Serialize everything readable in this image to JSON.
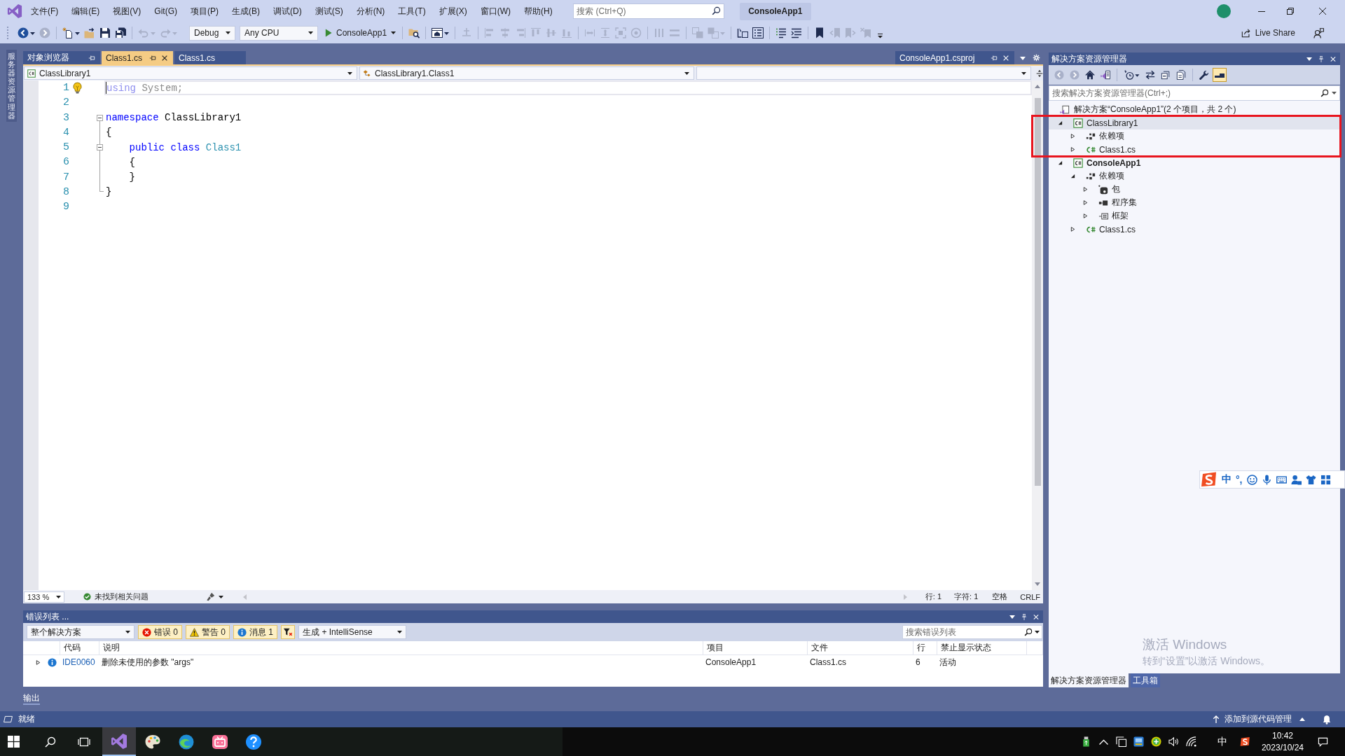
{
  "title_bar": {
    "menu": [
      "文件(F)",
      "编辑(E)",
      "视图(V)",
      "Git(G)",
      "项目(P)",
      "生成(B)",
      "调试(D)",
      "测试(S)",
      "分析(N)",
      "工具(T)",
      "扩展(X)",
      "窗口(W)",
      "帮助(H)"
    ],
    "search": {
      "placeholder": "搜索 (Ctrl+Q)"
    },
    "solution_name": "ConsoleApp1"
  },
  "toolbar": {
    "groups_before": [
      [
        {
          "kind": "back",
          "disabled": false,
          "menu": true
        },
        {
          "kind": "forward",
          "disabled": true,
          "menu": false
        }
      ],
      [
        {
          "kind": "new-item",
          "disabled": false,
          "menu": true
        },
        {
          "kind": "folder-open",
          "disabled": false,
          "menu": false
        },
        {
          "kind": "save",
          "disabled": false,
          "menu": false
        },
        {
          "kind": "save-all",
          "disabled": false,
          "menu": false
        }
      ],
      [
        {
          "kind": "undo",
          "disabled": true,
          "menu": true
        },
        {
          "kind": "redo",
          "disabled": true,
          "menu": true
        }
      ]
    ],
    "configuration": "Debug",
    "platform": "Any CPU",
    "start": "ConsoleApp1",
    "groups_after": [
      [
        {
          "kind": "folder-search",
          "disabled": false,
          "menu": false
        }
      ],
      [
        {
          "kind": "browser-window",
          "disabled": false,
          "menu": true
        }
      ],
      [
        {
          "kind": "snap-line",
          "disabled": true,
          "menu": false
        }
      ],
      [
        {
          "kind": "align-left",
          "disabled": true,
          "menu": false
        },
        {
          "kind": "align-center",
          "disabled": true,
          "menu": false
        },
        {
          "kind": "align-right",
          "disabled": true,
          "menu": false
        },
        {
          "kind": "align-top",
          "disabled": true,
          "menu": false
        },
        {
          "kind": "align-middle",
          "disabled": true,
          "menu": false
        },
        {
          "kind": "align-bottom",
          "disabled": true,
          "menu": false
        }
      ],
      [
        {
          "kind": "same-width",
          "disabled": true,
          "menu": false
        },
        {
          "kind": "same-height",
          "disabled": true,
          "menu": false
        },
        {
          "kind": "size-to-grid",
          "disabled": true,
          "menu": false
        },
        {
          "kind": "target",
          "disabled": true,
          "menu": false
        }
      ],
      [
        {
          "kind": "h-spacing",
          "disabled": true,
          "menu": false
        },
        {
          "kind": "v-spacing",
          "disabled": true,
          "menu": false
        }
      ],
      [
        {
          "kind": "bring-front",
          "disabled": true,
          "menu": false
        },
        {
          "kind": "send-back",
          "disabled": true,
          "menu": true
        }
      ],
      [
        {
          "kind": "go-to-member",
          "disabled": false,
          "menu": false
        },
        {
          "kind": "member-list",
          "disabled": false,
          "menu": false
        }
      ],
      [
        {
          "kind": "comment",
          "disabled": false,
          "menu": false
        },
        {
          "kind": "uncomment",
          "disabled": false,
          "menu": false
        }
      ],
      [
        {
          "kind": "bookmark",
          "disabled": false,
          "menu": false
        },
        {
          "kind": "bookmark-prev",
          "disabled": true,
          "menu": false
        },
        {
          "kind": "bookmark-next",
          "disabled": true,
          "menu": false
        },
        {
          "kind": "bookmark-clear",
          "disabled": true,
          "menu": false
        }
      ]
    ],
    "live_share": "Live Share"
  },
  "side_strip": {
    "label": "服务器资源管理器"
  },
  "document_tabs": [
    {
      "label": "对象浏览器",
      "kind": "tool",
      "selected": false
    },
    {
      "label": "Class1.cs",
      "kind": "file",
      "selected": true
    },
    {
      "label": "Class1.cs",
      "kind": "file",
      "selected": false
    },
    {
      "label": "ConsoleApp1.csproj",
      "kind": "preview",
      "selected": false
    }
  ],
  "nav_bar": {
    "project": "ClassLibrary1",
    "type": "ClassLibrary1.Class1"
  },
  "editor": {
    "lines": [
      {
        "number": "1",
        "kind": "plain",
        "current": true,
        "lightbulb": true,
        "tokens": [
          {
            "text": "using",
            "kind": "unused-keyword"
          },
          {
            "text": " System;",
            "kind": "unused"
          }
        ]
      },
      {
        "number": "2",
        "kind": "plain",
        "current": false,
        "lightbulb": false
      },
      {
        "number": "3",
        "kind": "fold-start",
        "current": false,
        "lightbulb": false,
        "tokens": [
          {
            "text": "namespace",
            "kind": "keyword"
          },
          {
            "text": " ClassLibrary1",
            "kind": "plain"
          }
        ]
      },
      {
        "number": "4",
        "kind": "fold-inside",
        "current": false,
        "lightbulb": false,
        "tokens": [
          {
            "text": "{",
            "kind": "plain"
          }
        ]
      },
      {
        "number": "5",
        "kind": "nested-fold-start",
        "current": false,
        "lightbulb": false,
        "tokens": [
          {
            "text": "    public",
            "kind": "keyword"
          },
          {
            "text": " class",
            "kind": "keyword"
          },
          {
            "text": " Class1",
            "kind": "type"
          }
        ]
      },
      {
        "number": "6",
        "kind": "fold-inside",
        "current": false,
        "lightbulb": false,
        "tokens": [
          {
            "text": "    {",
            "kind": "plain"
          }
        ]
      },
      {
        "number": "7",
        "kind": "fold-inside",
        "current": false,
        "lightbulb": false,
        "tokens": [
          {
            "text": "    }",
            "kind": "plain"
          }
        ]
      },
      {
        "number": "8",
        "kind": "fold-end",
        "current": false,
        "lightbulb": false,
        "tokens": [
          {
            "text": "}",
            "kind": "plain"
          }
        ]
      },
      {
        "number": "9",
        "kind": "plain",
        "current": false,
        "lightbulb": false
      }
    ],
    "status": {
      "zoom": "133 %",
      "issues": "未找到相关问题",
      "line": "行: 1",
      "column": "字符: 1",
      "indent": "空格",
      "line_ending": "CRLF"
    }
  },
  "error_list": {
    "title": "错误列表 ...",
    "scope": "整个解决方案",
    "filters": [
      {
        "kind": "error",
        "label": "错误 0",
        "selected": true
      },
      {
        "kind": "warning",
        "label": "警告 0",
        "selected": true
      },
      {
        "kind": "info",
        "label": "消息 1",
        "selected": true
      }
    ],
    "filter_selected": true,
    "source": "生成 + IntelliSense",
    "search": {
      "placeholder": "搜索错误列表"
    },
    "columns": [
      "代码",
      "说明",
      "项目",
      "文件",
      "行",
      "禁止显示状态"
    ],
    "rows": [
      {
        "kind": "info",
        "expanded": false,
        "code": "IDE0060",
        "description": "删除未使用的参数 \"args\"",
        "project": "ConsoleApp1",
        "file": "Class1.cs",
        "line": "6",
        "state": "活动"
      }
    ]
  },
  "output_tab": {
    "label": "输出"
  },
  "solution_explorer": {
    "title": "解决方案资源管理器",
    "toolbar": [
      [
        {
          "kind": "back",
          "disabled": true,
          "selected": false,
          "menu": false
        },
        {
          "kind": "forward",
          "disabled": true,
          "selected": false,
          "menu": false
        },
        {
          "kind": "home",
          "disabled": false,
          "selected": false,
          "menu": false
        },
        {
          "kind": "switch-views",
          "disabled": false,
          "selected": false,
          "menu": false
        }
      ],
      [
        {
          "kind": "history",
          "disabled": false,
          "selected": false,
          "menu": true
        },
        {
          "kind": "sync",
          "disabled": false,
          "selected": false,
          "menu": false
        },
        {
          "kind": "collapse-all",
          "disabled": false,
          "selected": false,
          "menu": false
        },
        {
          "kind": "show-all-files",
          "disabled": false,
          "selected": false,
          "menu": false
        }
      ],
      [
        {
          "kind": "properties",
          "disabled": false,
          "selected": false,
          "menu": false
        },
        {
          "kind": "preview",
          "disabled": false,
          "selected": true,
          "menu": false
        }
      ]
    ],
    "search": {
      "placeholder": "搜索解决方案资源管理器(Ctrl+;)"
    },
    "tree": [
      {
        "label": "解决方案“ConsoleApp1”(2 个项目，共 2 个)",
        "kind": "solution",
        "selected": false,
        "startup": false,
        "annotated": false,
        "children": [
          {
            "label": "ClassLibrary1",
            "kind": "project",
            "expanded": true,
            "selected": true,
            "startup": false,
            "annotated": true,
            "children": [
              {
                "label": "依赖项",
                "kind": "dependencies",
                "expanded": false,
                "selected": false,
                "startup": false,
                "annotated": false
              },
              {
                "label": "Class1.cs",
                "kind": "csharp-file",
                "expanded": false,
                "selected": false,
                "startup": false,
                "annotated": false
              }
            ]
          },
          {
            "label": "ConsoleApp1",
            "kind": "project",
            "expanded": true,
            "selected": false,
            "startup": true,
            "annotated": false,
            "children": [
              {
                "label": "依赖项",
                "kind": "dependencies",
                "expanded": true,
                "selected": false,
                "startup": false,
                "annotated": false,
                "children": [
                  {
                    "label": "包",
                    "kind": "packages",
                    "expanded": false,
                    "selected": false,
                    "startup": false,
                    "annotated": false
                  },
                  {
                    "label": "程序集",
                    "kind": "assemblies",
                    "expanded": false,
                    "selected": false,
                    "startup": false,
                    "annotated": false
                  },
                  {
                    "label": "框架",
                    "kind": "frameworks",
                    "expanded": false,
                    "selected": false,
                    "startup": false,
                    "annotated": false
                  }
                ]
              },
              {
                "label": "Class1.cs",
                "kind": "csharp-file",
                "expanded": false,
                "selected": false,
                "startup": false,
                "annotated": false
              }
            ]
          }
        ]
      }
    ],
    "tabs": [
      {
        "label": "解决方案资源管理器",
        "selected": true
      },
      {
        "label": "工具箱",
        "selected": false
      }
    ]
  },
  "ime_bar": {
    "mode": "中",
    "punctuation": "°,"
  },
  "activation_notice": {
    "title": "激活 Windows",
    "hint": "转到“设置”以激活 Windows。"
  },
  "status_bar": {
    "text": "就绪",
    "source_control": "添加到源代码管理"
  },
  "taskbar": {
    "apps": [
      {
        "kind": "ide",
        "selected": true
      },
      {
        "kind": "paint",
        "selected": false
      },
      {
        "kind": "browser",
        "selected": false
      },
      {
        "kind": "video",
        "selected": false
      },
      {
        "kind": "help",
        "selected": false
      }
    ],
    "input_mode": "中",
    "time": "10:42",
    "date": "2023/10/24"
  }
}
